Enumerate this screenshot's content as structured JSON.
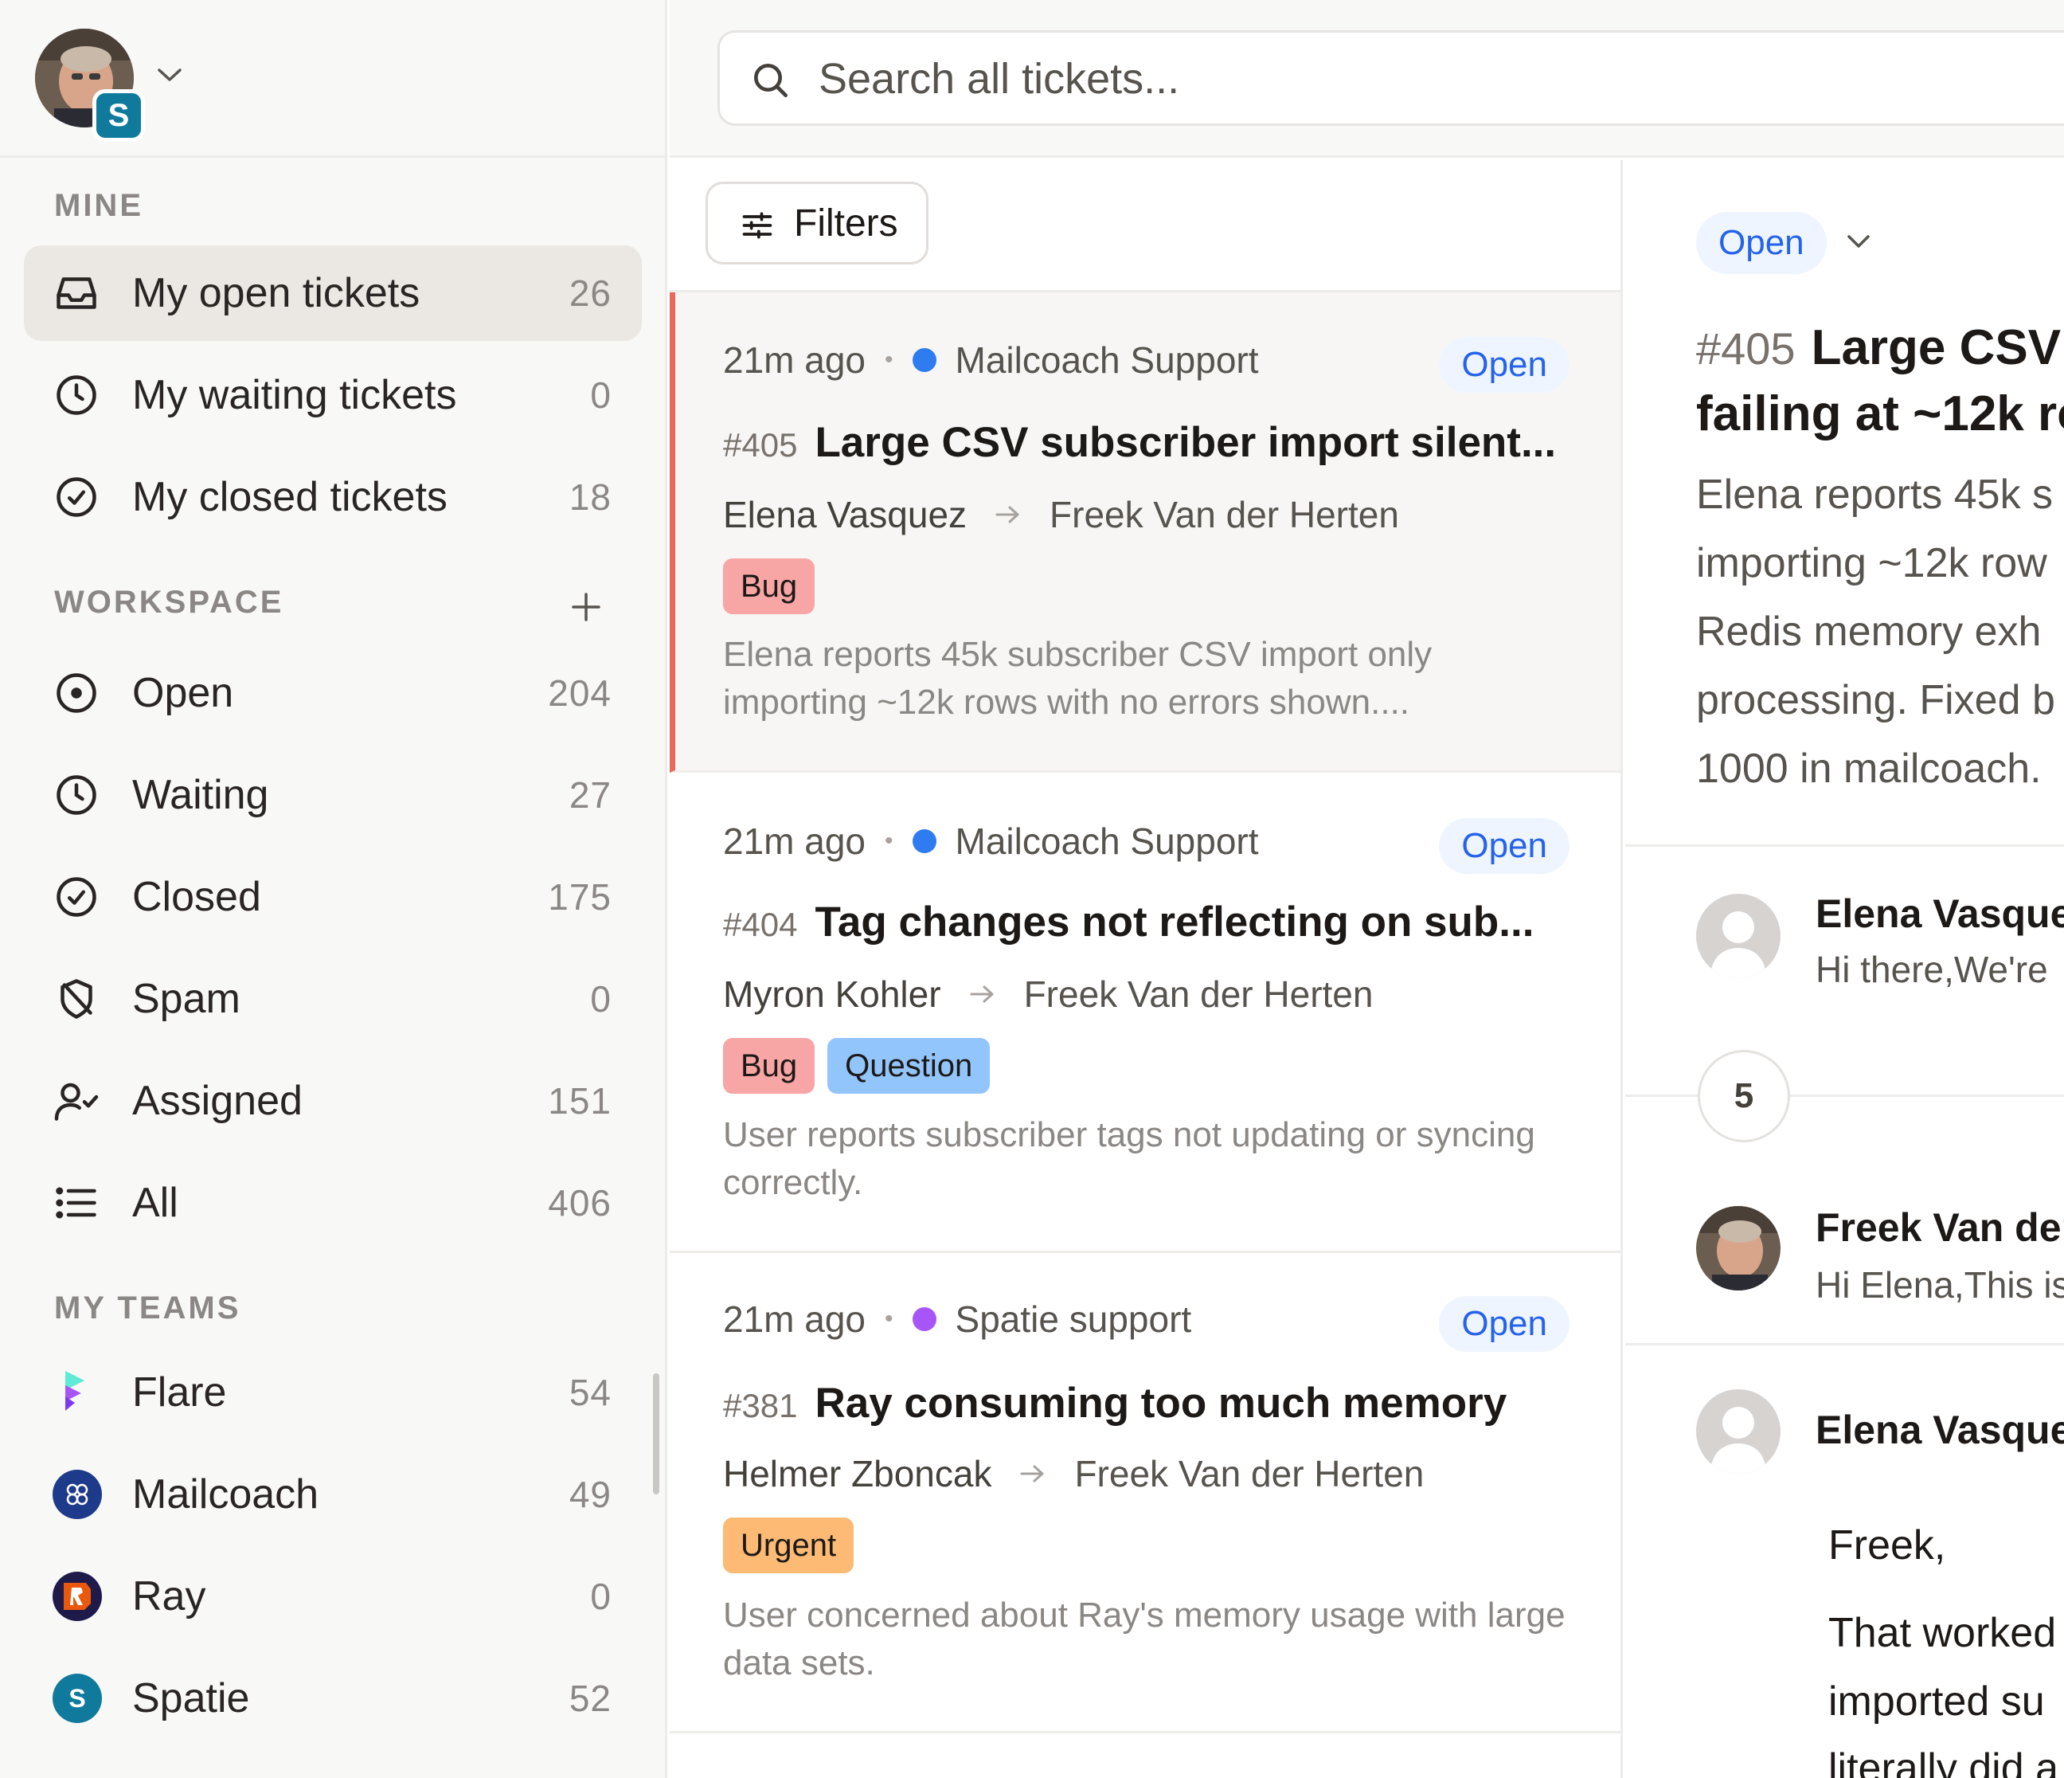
{
  "sidebar": {
    "mine_label": "MINE",
    "workspace_label": "WORKSPACE",
    "teams_label": "MY TEAMS",
    "user_team_badge": "S",
    "mine_items": [
      {
        "label": "My open tickets",
        "count": "26",
        "icon": "inbox-icon",
        "active": true
      },
      {
        "label": "My waiting tickets",
        "count": "0",
        "icon": "clock-icon"
      },
      {
        "label": "My closed tickets",
        "count": "18",
        "icon": "check-circle-icon"
      }
    ],
    "workspace_items": [
      {
        "label": "Open",
        "count": "204",
        "icon": "dot-circle-icon"
      },
      {
        "label": "Waiting",
        "count": "27",
        "icon": "clock-icon"
      },
      {
        "label": "Closed",
        "count": "175",
        "icon": "check-circle-icon"
      },
      {
        "label": "Spam",
        "count": "0",
        "icon": "shield-slash-icon"
      },
      {
        "label": "Assigned",
        "count": "151",
        "icon": "user-check-icon"
      },
      {
        "label": "All",
        "count": "406",
        "icon": "list-icon"
      }
    ],
    "teams": [
      {
        "label": "Flare",
        "count": "54",
        "icon": "flare-logo-icon"
      },
      {
        "label": "Mailcoach",
        "count": "49",
        "icon": "mailcoach-logo-icon"
      },
      {
        "label": "Ray",
        "count": "0",
        "icon": "ray-logo-icon"
      },
      {
        "label": "Spatie",
        "count": "52",
        "icon": "spatie-logo-icon",
        "letter": "S"
      }
    ]
  },
  "search": {
    "placeholder": "Search all tickets..."
  },
  "list": {
    "filters_label": "Filters",
    "tickets": [
      {
        "time": "21m ago",
        "team": "Mailcoach Support",
        "team_color": "#2f7bf0",
        "status": "Open",
        "number": "#405",
        "subject": "Large CSV subscriber import silent...",
        "from": "Elena Vasquez",
        "to": "Freek Van der Herten",
        "tags": [
          "Bug"
        ],
        "excerpt": "Elena reports 45k subscriber CSV import only importing ~12k rows with no errors shown...."
      },
      {
        "time": "21m ago",
        "team": "Mailcoach Support",
        "team_color": "#2f7bf0",
        "status": "Open",
        "number": "#404",
        "subject": "Tag changes not reflecting on sub...",
        "from": "Myron Kohler",
        "to": "Freek Van der Herten",
        "tags": [
          "Bug",
          "Question"
        ],
        "excerpt": "User reports subscriber tags not updating or syncing correctly."
      },
      {
        "time": "21m ago",
        "team": "Spatie support",
        "team_color": "#a855f7",
        "status": "Open",
        "number": "#381",
        "subject": "Ray consuming too much memory",
        "from": "Helmer Zboncak",
        "to": "Freek Van der Herten",
        "tags": [
          "Urgent"
        ],
        "excerpt": "User concerned about Ray's memory usage with large data sets."
      }
    ]
  },
  "detail": {
    "status": "Open",
    "number": "#405",
    "title_line1": "Large CSV",
    "title_line2": "failing at ~12k ro",
    "summary": "Elena reports 45k s\nimporting ~12k row\nRedis memory exh\nprocessing. Fixed b\n1000 in mailcoach.",
    "messages": [
      {
        "name": "Elena Vasque",
        "preview": "Hi there,We're"
      },
      {
        "name": "Freek Van der",
        "preview": "Hi Elena,This is"
      },
      {
        "name": "Elena Vasque",
        "preview": ""
      }
    ],
    "collapsed_count": "5",
    "body": [
      "Freek,",
      "That worked",
      "imported su",
      "literally did a"
    ]
  }
}
